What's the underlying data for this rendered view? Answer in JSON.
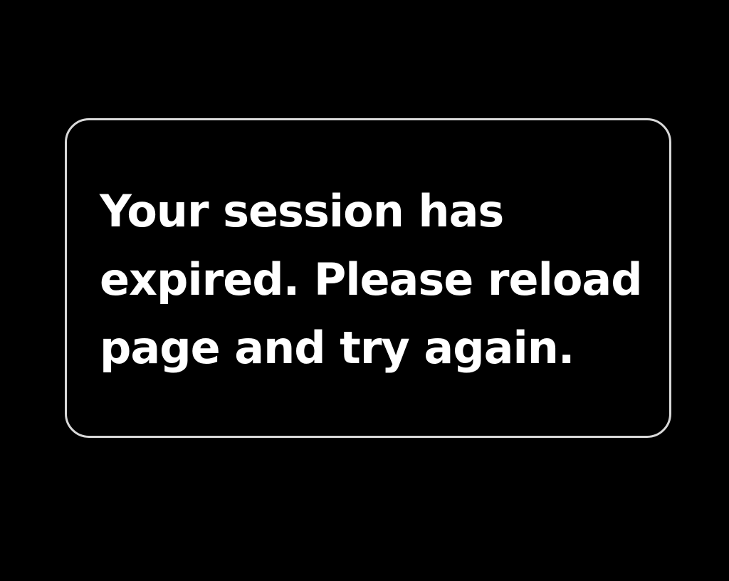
{
  "dialog": {
    "message_line1": "Your session has",
    "message_line2": "expired. Please reload",
    "message_line3": "page and try again."
  },
  "colors": {
    "background": "#000000",
    "border": "#d9d9d9",
    "text": "#ffffff"
  }
}
